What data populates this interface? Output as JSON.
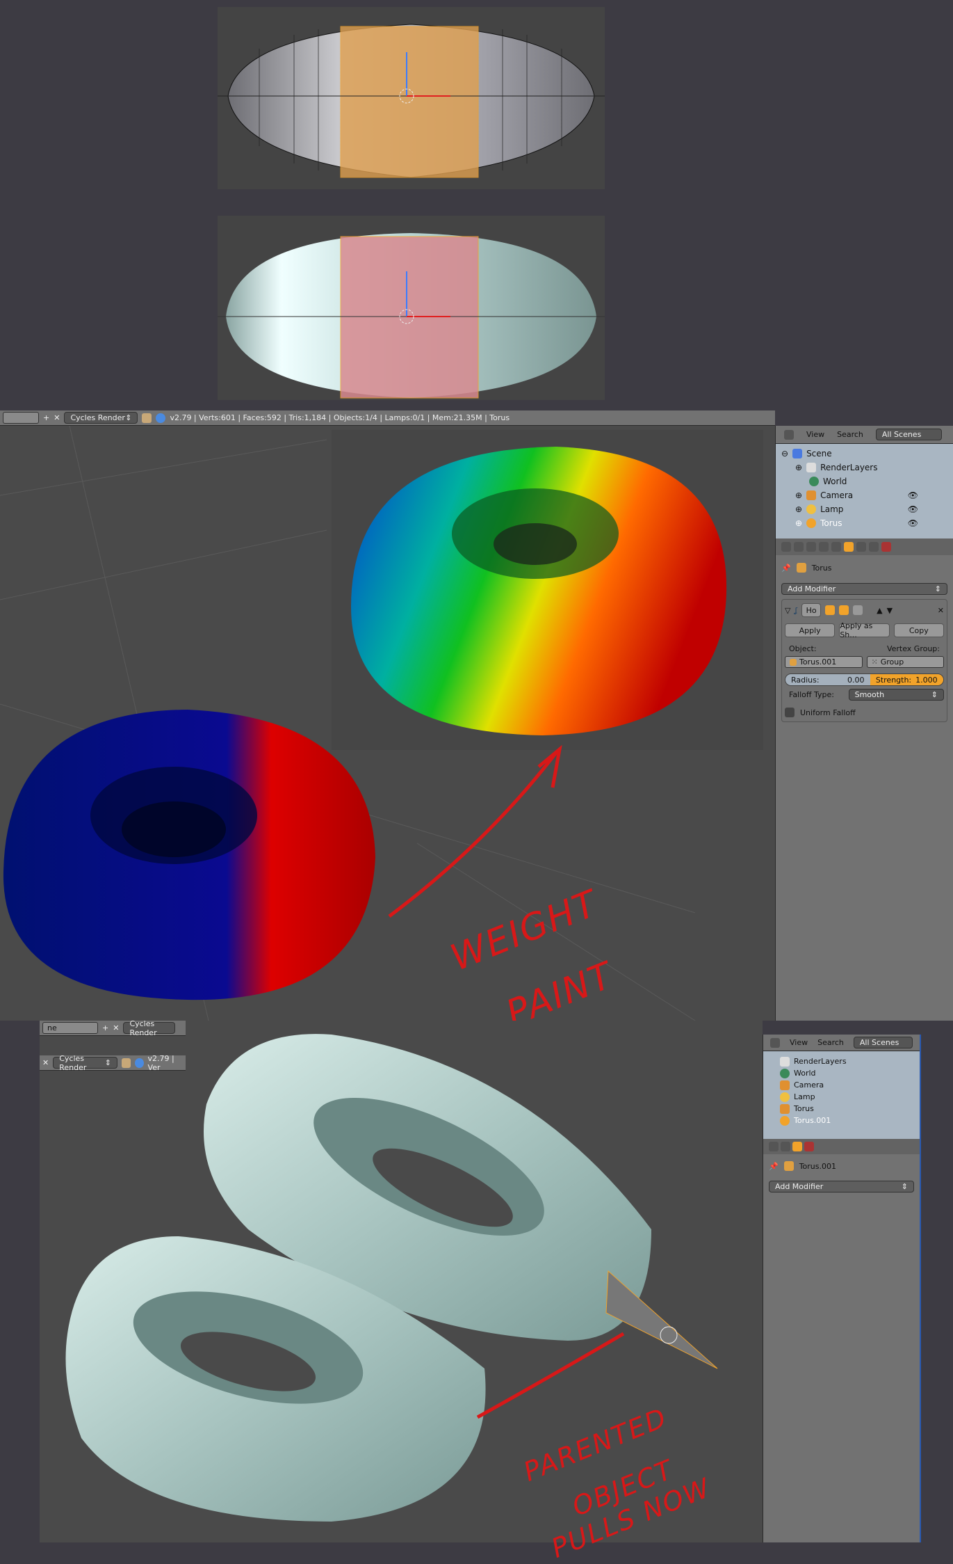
{
  "header": {
    "render_engine": "Cycles Render",
    "stats": "v2.79 | Verts:601 | Faces:592 | Tris:1,184 | Objects:1/4 | Lamps:0/1 | Mem:21.35M | Torus"
  },
  "outliner": {
    "menu": [
      "View",
      "Search"
    ],
    "scope": "All Scenes",
    "items": [
      {
        "label": "Scene",
        "icon": "scene-icon"
      },
      {
        "label": "RenderLayers",
        "icon": "render-layers-icon"
      },
      {
        "label": "World",
        "icon": "world-icon"
      },
      {
        "label": "Camera",
        "icon": "camera-icon"
      },
      {
        "label": "Lamp",
        "icon": "lamp-icon"
      },
      {
        "label": "Torus",
        "icon": "mesh-icon",
        "selected": true
      }
    ]
  },
  "properties": {
    "context_object": "Torus",
    "add_modifier": "Add Modifier",
    "modifier": {
      "name": "Ho",
      "apply": "Apply",
      "apply_shape": "Apply as Sh...",
      "copy": "Copy",
      "object_label": "Object:",
      "object_value": "Torus.001",
      "vgroup_label": "Vertex Group:",
      "vgroup_value": "Group",
      "radius_label": "Radius:",
      "radius_value": "0.00",
      "strength_label": "Strength:",
      "strength_value": "1.000",
      "falloff_label": "Falloff Type:",
      "falloff_value": "Smooth",
      "uniform_label": "Uniform Falloff",
      "uniform_checked": false
    }
  },
  "bottom": {
    "scene_field": "ne",
    "render_engine_top": "Cycles Render",
    "render_engine": "Cycles Render",
    "stats": "v2.79 | Ver",
    "outliner": {
      "menu": [
        "View",
        "Search"
      ],
      "scope": "All Scenes",
      "items": [
        {
          "label": "RenderLayers"
        },
        {
          "label": "World"
        },
        {
          "label": "Camera"
        },
        {
          "label": "Lamp"
        },
        {
          "label": "Torus"
        },
        {
          "label": "Torus.001",
          "selected": true
        }
      ]
    },
    "context_object": "Torus.001",
    "add_modifier": "Add Modifier"
  },
  "annotations": {
    "weight_paint": [
      "WEIGHT",
      "PAINT"
    ],
    "parented": [
      "PARENTED",
      "OBJECT",
      "PULLS NOW"
    ]
  },
  "colors": {
    "accent": "#f2a32a",
    "annotation": "#d81818",
    "selection": "#f2a32a"
  }
}
